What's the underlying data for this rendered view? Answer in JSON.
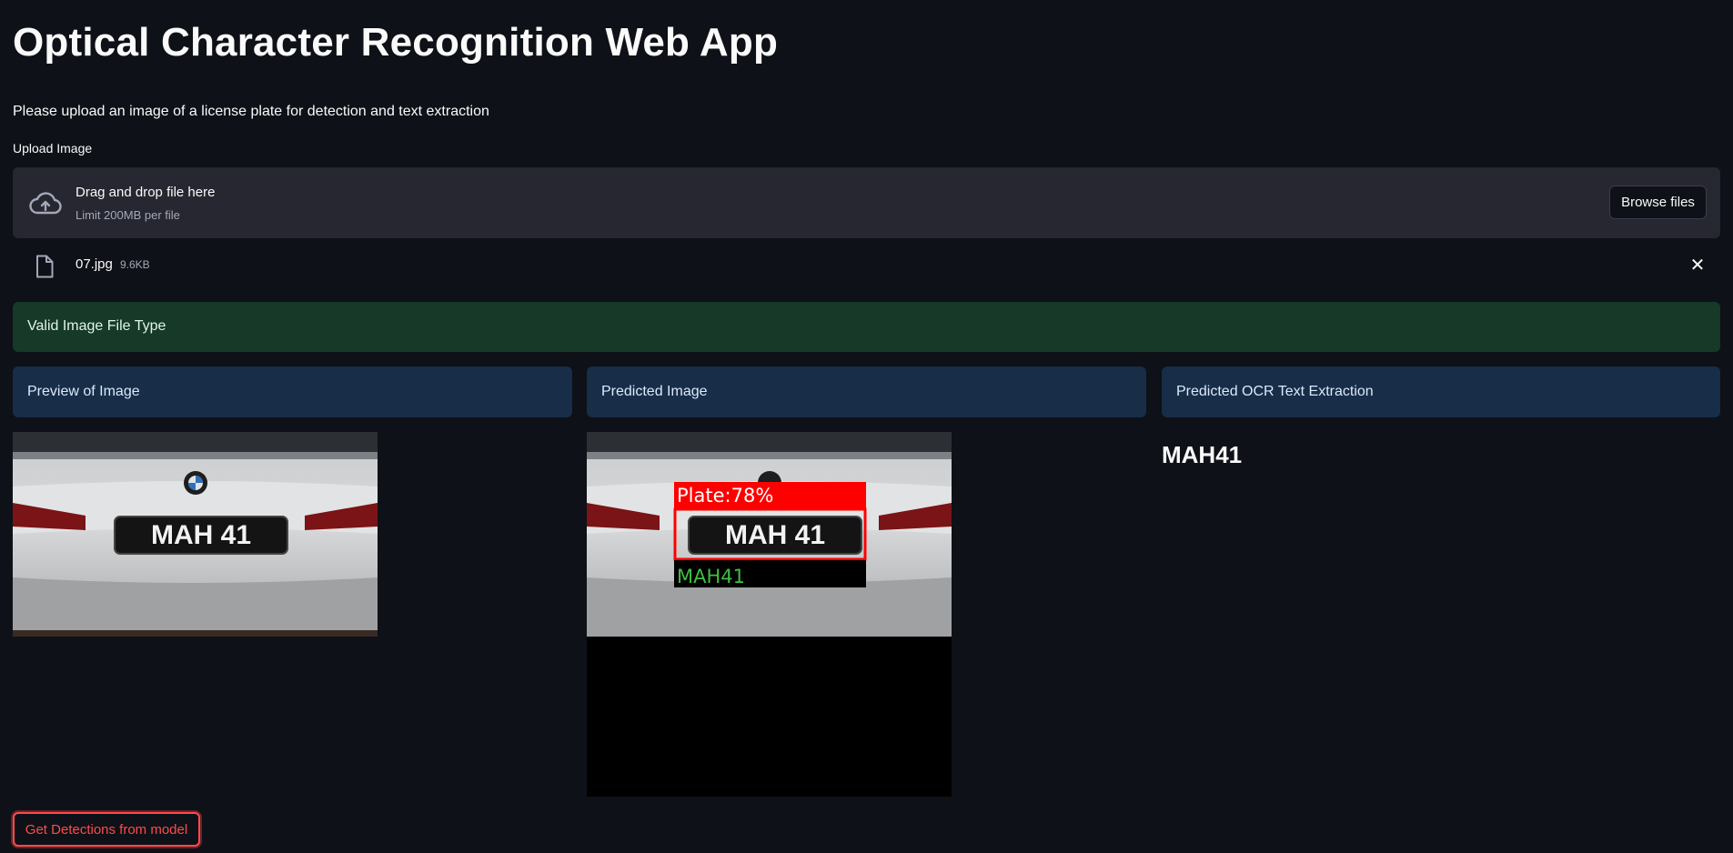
{
  "app": {
    "title": "Optical Character Recognition Web App",
    "subtitle": "Please upload an image of a license plate for detection and text extraction"
  },
  "upload": {
    "label": "Upload Image",
    "drag_text": "Drag and drop file here",
    "limit_text": "Limit 200MB per file",
    "browse_label": "Browse files",
    "icon": "cloud-upload-icon"
  },
  "file": {
    "name": "07.jpg",
    "size": "9.6KB",
    "remove_glyph": "✕"
  },
  "status": {
    "success_text": "Valid Image File Type",
    "color": "#173928"
  },
  "columns": [
    {
      "header": "Preview of Image"
    },
    {
      "header": "Predicted Image"
    },
    {
      "header": "Predicted OCR Text Extraction"
    }
  ],
  "image": {
    "plate_text": "MAH 41",
    "detection_label": "Plate:78%",
    "detection_ocr": "MAH41"
  },
  "ocr_result": "MAH41",
  "actions": {
    "detect_label": "Get Detections from model",
    "accent": "#ff4b4b"
  }
}
